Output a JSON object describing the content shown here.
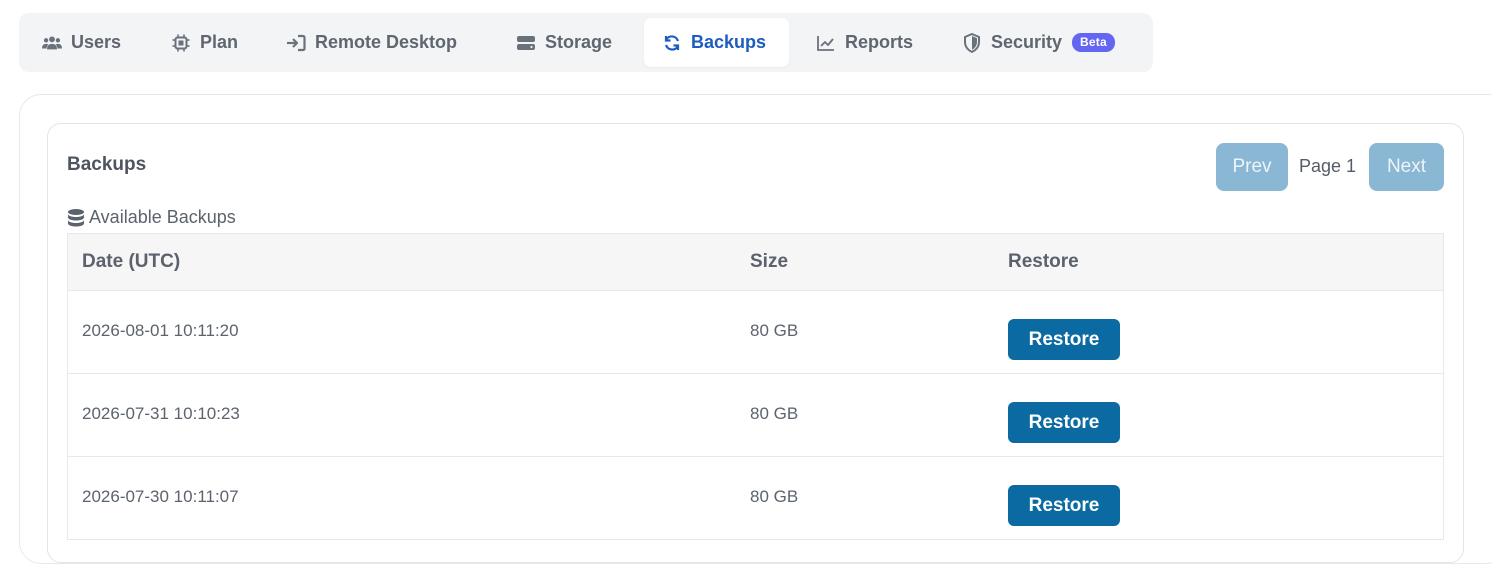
{
  "tabs": [
    {
      "label": "Users",
      "icon": "users-icon",
      "active": false
    },
    {
      "label": "Plan",
      "icon": "chip-icon",
      "active": false
    },
    {
      "label": "Remote Desktop",
      "icon": "sign-in-icon",
      "active": false
    },
    {
      "label": "Storage",
      "icon": "storage-drive-icon",
      "active": false
    },
    {
      "label": "Backups",
      "icon": "sync-icon",
      "active": true
    },
    {
      "label": "Reports",
      "icon": "line-chart-icon",
      "active": false
    },
    {
      "label": "Security",
      "icon": "shield-icon",
      "active": false,
      "badge": "Beta"
    }
  ],
  "colors": {
    "active_tab": "#1d5cc0",
    "badge": "#6366f1",
    "restore_button": "#0b6aa1",
    "pager_disabled": "#8ab7d3"
  },
  "panel": {
    "title": "Backups",
    "pagination": {
      "prev_label": "Prev",
      "page_label": "Page 1",
      "next_label": "Next"
    },
    "list_heading": "Available Backups",
    "list_icon": "database-icon"
  },
  "table": {
    "columns": [
      "Date (UTC)",
      "Size",
      "Restore"
    ],
    "rows": [
      {
        "date": "2026-08-01 10:11:20",
        "size": "80 GB",
        "action": "Restore"
      },
      {
        "date": "2026-07-31 10:10:23",
        "size": "80 GB",
        "action": "Restore"
      },
      {
        "date": "2026-07-30 10:11:07",
        "size": "80 GB",
        "action": "Restore"
      }
    ]
  }
}
